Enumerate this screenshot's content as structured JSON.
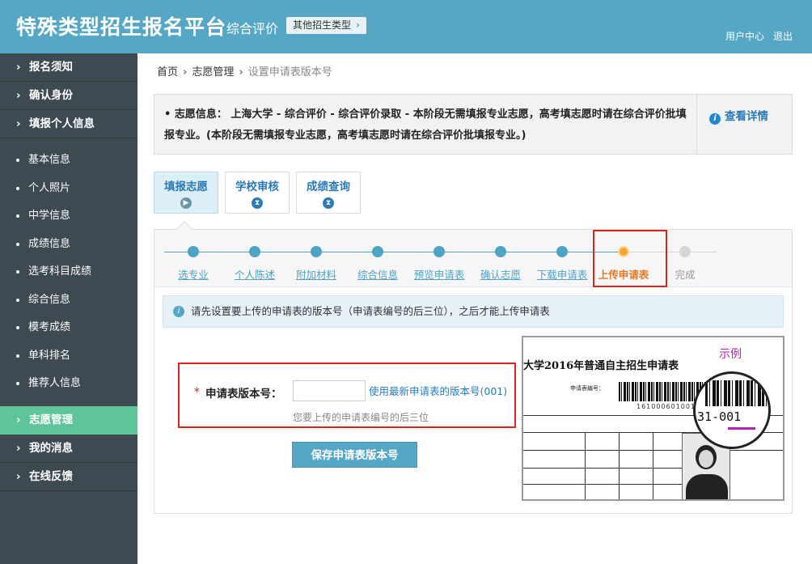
{
  "header": {
    "title": "特殊类型招生报名平台",
    "subtitle": "综合评价",
    "type_button": "其他招生类型",
    "user_center": "用户中心",
    "logout": "退出"
  },
  "sidebar": {
    "sections": [
      {
        "label": "报名须知"
      },
      {
        "label": "确认身份"
      },
      {
        "label": "填报个人信息"
      }
    ],
    "sub_items": [
      {
        "label": "基本信息"
      },
      {
        "label": "个人照片"
      },
      {
        "label": "中学信息"
      },
      {
        "label": "成绩信息"
      },
      {
        "label": "选考科目成绩"
      },
      {
        "label": "综合信息"
      },
      {
        "label": "模考成绩"
      },
      {
        "label": "单科排名"
      },
      {
        "label": "推荐人信息"
      }
    ],
    "bottom_sections": [
      {
        "label": "志愿管理",
        "active": true
      },
      {
        "label": "我的消息"
      },
      {
        "label": "在线反馈"
      }
    ]
  },
  "breadcrumb": {
    "home": "首页",
    "level1": "志愿管理",
    "current": "设置申请表版本号"
  },
  "info": {
    "text": "志愿信息：  上海大学 - 综合评价 - 综合评价录取 - 本阶段无需填报专业志愿，高考填志愿时请在综合评价批填报专业。(本阶段无需填报专业志愿，高考填志愿时请在综合评价批填报专业。)",
    "bullet": "•",
    "detail_link": "查看详情"
  },
  "tabs": [
    {
      "label": "填报志愿",
      "active": true
    },
    {
      "label": "学校审核"
    },
    {
      "label": "成绩查询"
    }
  ],
  "steps": [
    {
      "label": "选专业"
    },
    {
      "label": "个人陈述"
    },
    {
      "label": "附加材料"
    },
    {
      "label": "综合信息"
    },
    {
      "label": "预览申请表"
    },
    {
      "label": "确认志愿"
    },
    {
      "label": "下载申请表"
    },
    {
      "label": "上传申请表",
      "state": "current"
    },
    {
      "label": "完成",
      "state": "todo"
    }
  ],
  "notice": "请先设置要上传的申请表的版本号（申请表编号的后三位），之后才能上传申请表",
  "form": {
    "required_mark": "*",
    "label": "申请表版本号：",
    "value": "",
    "use_latest": "使用最新申请表的版本号(001)",
    "hint": "您要上传的申请表编号的后三位",
    "save_button": "保存申请表版本号"
  },
  "example": {
    "label": "示例",
    "title": "大学2016年普通自主招生申请表",
    "small_label": "申请表编号：",
    "barcode_number": "161000601001",
    "zoom_number": "31-001"
  },
  "colors": {
    "header": "#56a7c5",
    "sidebar": "#3e4a52",
    "sidebar_active": "#5ec59b",
    "link": "#2a7ab8",
    "highlight": "#d9251c",
    "current_step": "#e6791f"
  }
}
